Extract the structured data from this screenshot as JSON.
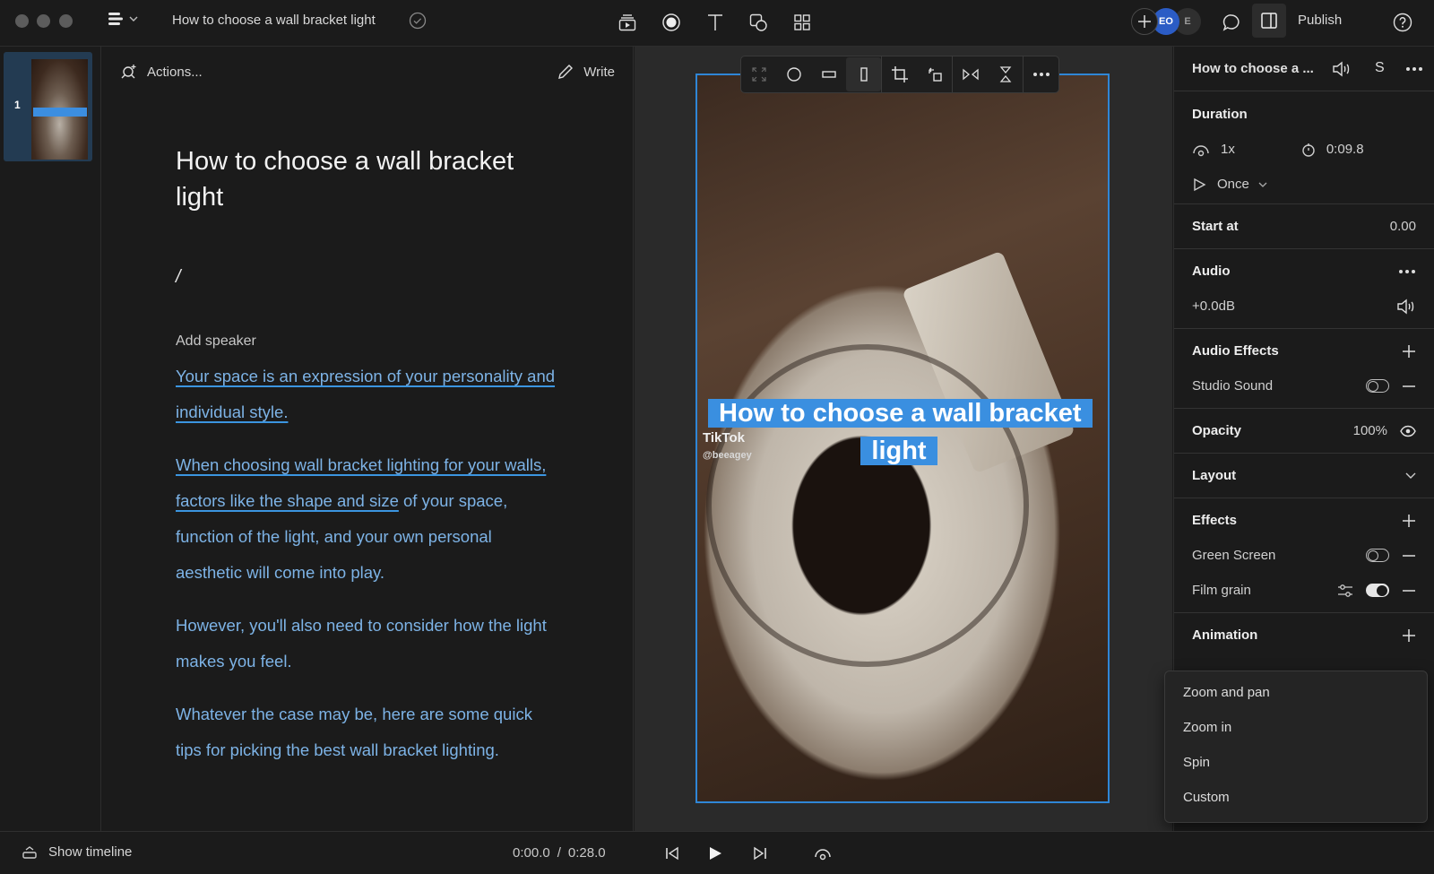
{
  "window": {
    "doc_title": "How to choose a wall bracket light",
    "saved_status": "saved",
    "toolbar_tools": [
      "scenes-icon",
      "record-icon",
      "text-icon",
      "shapes-icon",
      "grid-icon"
    ],
    "collaborators": [
      {
        "initials": "EO",
        "color": "#2b5cc5"
      },
      {
        "initials": "E",
        "color": "#2f2f2f"
      }
    ],
    "publish_label": "Publish"
  },
  "thumbnails": [
    {
      "number": "1",
      "selected": true
    }
  ],
  "editor": {
    "actions_label": "Actions...",
    "write_label": "Write",
    "title": "How to choose a wall bracket light",
    "cursor_text": "/",
    "speaker_label": "Add speaker",
    "paragraphs": [
      {
        "underlined": "Your space is an expression of your personality and individual style. ",
        "plain": ""
      },
      {
        "underlined": "When choosing wall bracket lighting for your walls, factors like the shape and size",
        "plain": " of your space, function of the light, and your own personal aesthetic will come into play."
      },
      {
        "underlined": "",
        "plain": "However, you'll also need to consider how the light makes you feel."
      },
      {
        "underlined": "",
        "plain": "Whatever the case may be, here are some quick tips for picking the best wall bracket lighting."
      }
    ]
  },
  "canvas": {
    "caption_text": "How to choose a wall bracket light",
    "watermark_brand": "TikTok",
    "watermark_user": "@beeagey",
    "accent_color": "#3a8fe0",
    "floating_toolbar": [
      "fit-icon",
      "circle-shape-icon",
      "landscape-shape-icon",
      "portrait-shape-icon",
      "crop-icon",
      "rotate-icon",
      "flip-horizontal-icon",
      "flip-vertical-icon",
      "more-icon"
    ],
    "active_tool": "portrait-shape-icon"
  },
  "properties": {
    "layer_name": "How to choose a ...",
    "layer_badge": "S",
    "duration": {
      "label": "Duration",
      "speed": "1x",
      "length": "0:09.8",
      "loop": "Once"
    },
    "start_at": {
      "label": "Start at",
      "value": "0.00"
    },
    "audio": {
      "label": "Audio",
      "gain": "+0.0dB"
    },
    "audio_effects": {
      "label": "Audio Effects",
      "items": [
        {
          "name": "Studio Sound",
          "enabled": false
        }
      ]
    },
    "opacity": {
      "label": "Opacity",
      "value": "100%"
    },
    "layout": {
      "label": "Layout"
    },
    "effects": {
      "label": "Effects",
      "items": [
        {
          "name": "Green Screen",
          "enabled": false
        },
        {
          "name": "Film grain",
          "enabled": true
        }
      ]
    },
    "animation": {
      "label": "Animation"
    }
  },
  "animation_menu": {
    "items": [
      "Zoom and pan",
      "Zoom in",
      "Spin",
      "Custom"
    ]
  },
  "bottom": {
    "show_timeline_label": "Show timeline",
    "current_time": "0:00.0",
    "separator": "/",
    "total_time": "0:28.0"
  }
}
